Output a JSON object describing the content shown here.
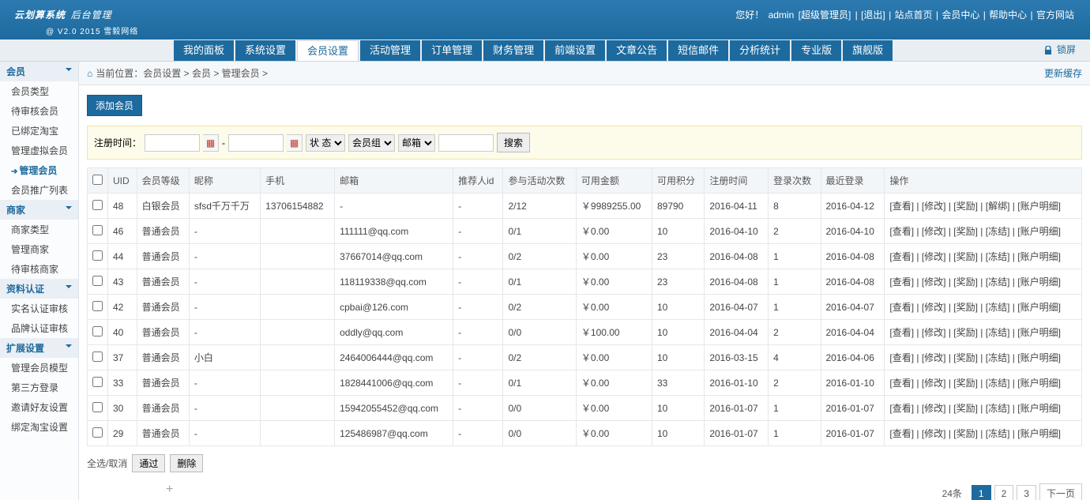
{
  "header": {
    "logo_main": "云划算系统",
    "logo_sub": "后台管理",
    "version": "@ V2.0 2015 雪毅网络",
    "greet": "您好！",
    "user": "admin",
    "role": "[超级管理员]",
    "links": [
      "[退出]",
      "站点首页",
      "会员中心",
      "帮助中心",
      "官方网站"
    ],
    "lock": "锁屏"
  },
  "nav": [
    "我的面板",
    "系统设置",
    "会员设置",
    "活动管理",
    "订单管理",
    "财务管理",
    "前端设置",
    "文章公告",
    "短信邮件",
    "分析统计",
    "专业版",
    "旗舰版"
  ],
  "nav_active": 2,
  "sidebar": [
    {
      "h": "会员",
      "items": [
        "会员类型",
        "待审核会员",
        "已绑定淘宝",
        "管理虚拟会员",
        "管理会员",
        "会员推广列表"
      ],
      "active": 4
    },
    {
      "h": "商家",
      "items": [
        "商家类型",
        "管理商家",
        "待审核商家"
      ]
    },
    {
      "h": "资料认证",
      "items": [
        "实名认证审核",
        "品牌认证审核"
      ]
    },
    {
      "h": "扩展设置",
      "items": [
        "管理会员模型",
        "第三方登录",
        "邀请好友设置",
        "绑定淘宝设置"
      ]
    }
  ],
  "crumb": {
    "prefix": "当前位置：",
    "parts": [
      "会员设置",
      "会员",
      "管理会员"
    ],
    "refresh": "更新缓存"
  },
  "add_btn": "添加会员",
  "filter": {
    "label": "注册时间：",
    "sep": "-",
    "status": "状 态",
    "group": "会员组",
    "mail": "邮箱",
    "search": "搜索"
  },
  "columns": [
    "",
    "UID",
    "会员等级",
    "昵称",
    "手机",
    "邮箱",
    "推荐人id",
    "参与活动次数",
    "可用金额",
    "可用积分",
    "注册时间",
    "登录次数",
    "最近登录",
    "操作"
  ],
  "ops": [
    "[查看]",
    "[修改]",
    "[奖励]",
    "[解绑]",
    "[账户明细]"
  ],
  "ops2": [
    "[查看]",
    "[修改]",
    "[奖励]",
    "[冻结]",
    "[账户明细]"
  ],
  "rows": [
    {
      "uid": "48",
      "lv": "白银会员",
      "nick": "sfsd千万千万",
      "phone": "13706154882",
      "mail": "-",
      "ref": "-",
      "act": "2/12",
      "bal": "￥9989255.00",
      "pts": "89790",
      "reg": "2016-04-11",
      "log": "8",
      "last": "2016-04-12",
      "op": 0
    },
    {
      "uid": "46",
      "lv": "普通会员",
      "nick": "-",
      "phone": "",
      "mail": "111111@qq.com",
      "ref": "-",
      "act": "0/1",
      "bal": "￥0.00",
      "pts": "10",
      "reg": "2016-04-10",
      "log": "2",
      "last": "2016-04-10",
      "op": 1
    },
    {
      "uid": "44",
      "lv": "普通会员",
      "nick": "-",
      "phone": "",
      "mail": "37667014@qq.com",
      "ref": "-",
      "act": "0/2",
      "bal": "￥0.00",
      "pts": "23",
      "reg": "2016-04-08",
      "log": "1",
      "last": "2016-04-08",
      "op": 1
    },
    {
      "uid": "43",
      "lv": "普通会员",
      "nick": "-",
      "phone": "",
      "mail": "118119338@qq.com",
      "ref": "-",
      "act": "0/1",
      "bal": "￥0.00",
      "pts": "23",
      "reg": "2016-04-08",
      "log": "1",
      "last": "2016-04-08",
      "op": 1
    },
    {
      "uid": "42",
      "lv": "普通会员",
      "nick": "-",
      "phone": "",
      "mail": "cpbai@126.com",
      "ref": "-",
      "act": "0/2",
      "bal": "￥0.00",
      "pts": "10",
      "reg": "2016-04-07",
      "log": "1",
      "last": "2016-04-07",
      "op": 1
    },
    {
      "uid": "40",
      "lv": "普通会员",
      "nick": "-",
      "phone": "",
      "mail": "oddly@qq.com",
      "ref": "-",
      "act": "0/0",
      "bal": "￥100.00",
      "pts": "10",
      "reg": "2016-04-04",
      "log": "2",
      "last": "2016-04-04",
      "op": 1
    },
    {
      "uid": "37",
      "lv": "普通会员",
      "nick": "小白",
      "phone": "",
      "mail": "2464006444@qq.com",
      "ref": "-",
      "act": "0/2",
      "bal": "￥0.00",
      "pts": "10",
      "reg": "2016-03-15",
      "log": "4",
      "last": "2016-04-06",
      "op": 1
    },
    {
      "uid": "33",
      "lv": "普通会员",
      "nick": "-",
      "phone": "",
      "mail": "1828441006@qq.com",
      "ref": "-",
      "act": "0/1",
      "bal": "￥0.00",
      "pts": "33",
      "reg": "2016-01-10",
      "log": "2",
      "last": "2016-01-10",
      "op": 1
    },
    {
      "uid": "30",
      "lv": "普通会员",
      "nick": "-",
      "phone": "",
      "mail": "15942055452@qq.com",
      "ref": "-",
      "act": "0/0",
      "bal": "￥0.00",
      "pts": "10",
      "reg": "2016-01-07",
      "log": "1",
      "last": "2016-01-07",
      "op": 1
    },
    {
      "uid": "29",
      "lv": "普通会员",
      "nick": "-",
      "phone": "",
      "mail": "125486987@qq.com",
      "ref": "-",
      "act": "0/0",
      "bal": "￥0.00",
      "pts": "10",
      "reg": "2016-01-07",
      "log": "1",
      "last": "2016-01-07",
      "op": 1
    }
  ],
  "foot": {
    "sel": "全选/取消",
    "pass": "通过",
    "del": "删除"
  },
  "pager": {
    "total": "24条",
    "pages": [
      "1",
      "2",
      "3"
    ],
    "cur": 0,
    "next": "下一页"
  }
}
